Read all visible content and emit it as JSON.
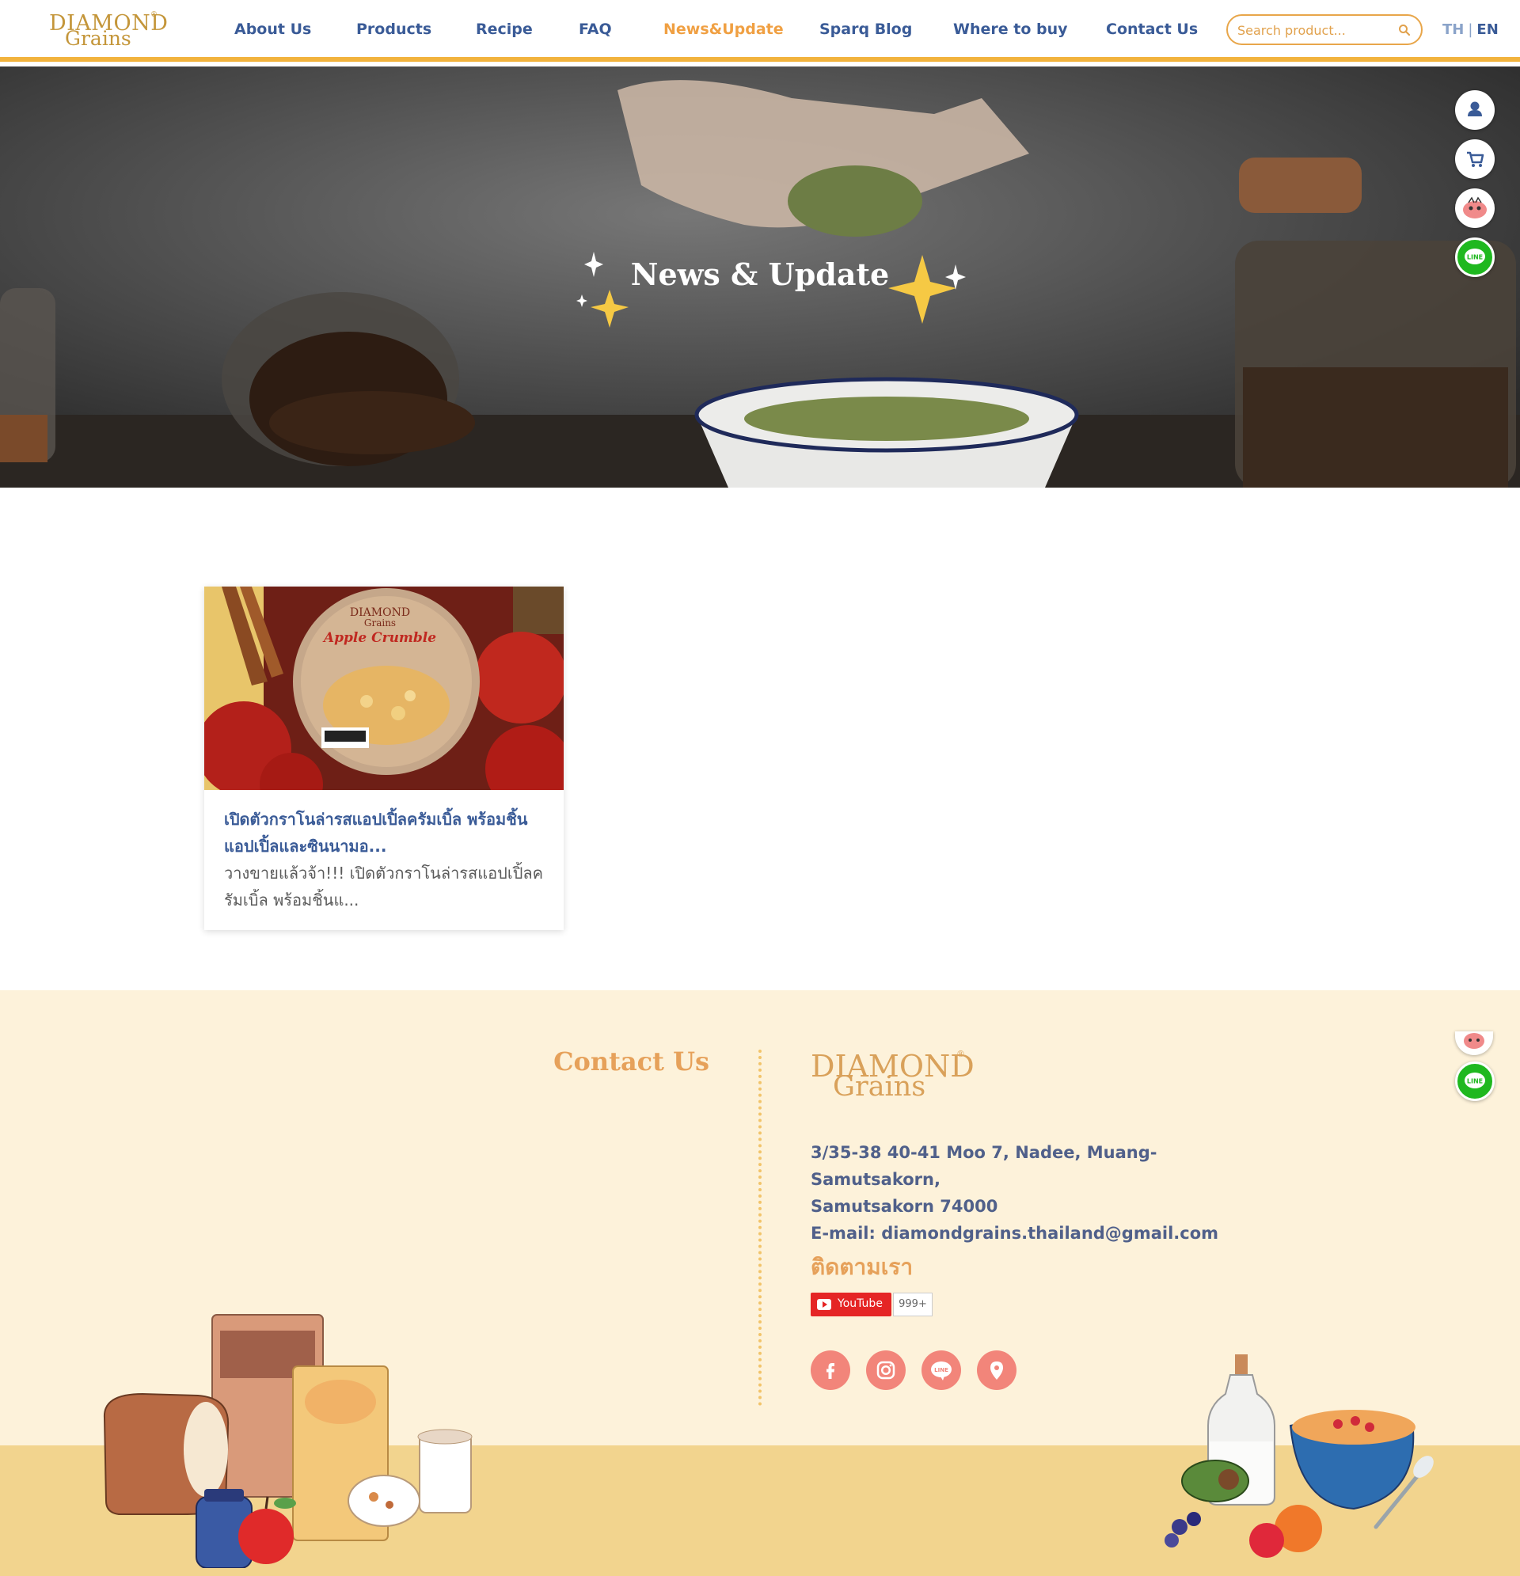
{
  "header": {
    "logo": {
      "line1": "DIAMOND",
      "line2": "Grains",
      "reg": "®"
    },
    "nav": [
      {
        "label": "About Us",
        "active": false
      },
      {
        "label": "Products",
        "active": false
      },
      {
        "label": "Recipe",
        "active": false
      },
      {
        "label": "FAQ",
        "active": false
      },
      {
        "label": "News&Update",
        "active": true
      },
      {
        "label": "Sparq Blog",
        "active": false
      },
      {
        "label": "Where to buy",
        "active": false
      },
      {
        "label": "Contact Us",
        "active": false
      }
    ],
    "search": {
      "placeholder": "Search product..."
    },
    "lang": {
      "th": "TH",
      "sep": "|",
      "en": "EN",
      "selected": "EN"
    }
  },
  "hero": {
    "title": "News & Update"
  },
  "floating_buttons": [
    "user-icon",
    "cart-icon",
    "mascot-icon",
    "line-icon"
  ],
  "news": [
    {
      "image_label": {
        "brand1": "DIAMOND",
        "brand2": "Grains",
        "product": "Apple Crumble"
      },
      "title": "เปิดตัวกราโนล่ารสแอปเปิ้ลครัมเบิ้ล พร้อมชิ้นแอปเปิ้ลและซินนามอ...",
      "excerpt": "วางขายแล้วจ้า!!! เปิดตัวกราโนล่ารสแอปเปิ้ลครัมเบิ้ล พร้อมชิ้นแ..."
    }
  ],
  "footer": {
    "contact_title": "Contact Us",
    "logo": {
      "line1": "DIAMOND",
      "line2": "Grains",
      "reg": "®"
    },
    "address": [
      "3/35-38 40-41 Moo 7, Nadee, Muang-Samutsakorn,",
      "Samutsakorn 74000",
      "E-mail: diamondgrains.thailand@gmail.com"
    ],
    "follow_title": "ติดตามเรา",
    "youtube": {
      "label": "YouTube",
      "count": "999+"
    },
    "socials": [
      "facebook-icon",
      "instagram-icon",
      "line-icon",
      "map-pin-icon"
    ]
  },
  "colors": {
    "brand_blue": "#3a5b97",
    "accent_orange": "#f0a043",
    "header_bar": "#f2b33d",
    "footer_bg": "#fdf2da",
    "footer_band": "#f2d48e",
    "social_bg": "#f2857a",
    "line_green": "#1fb81f"
  }
}
